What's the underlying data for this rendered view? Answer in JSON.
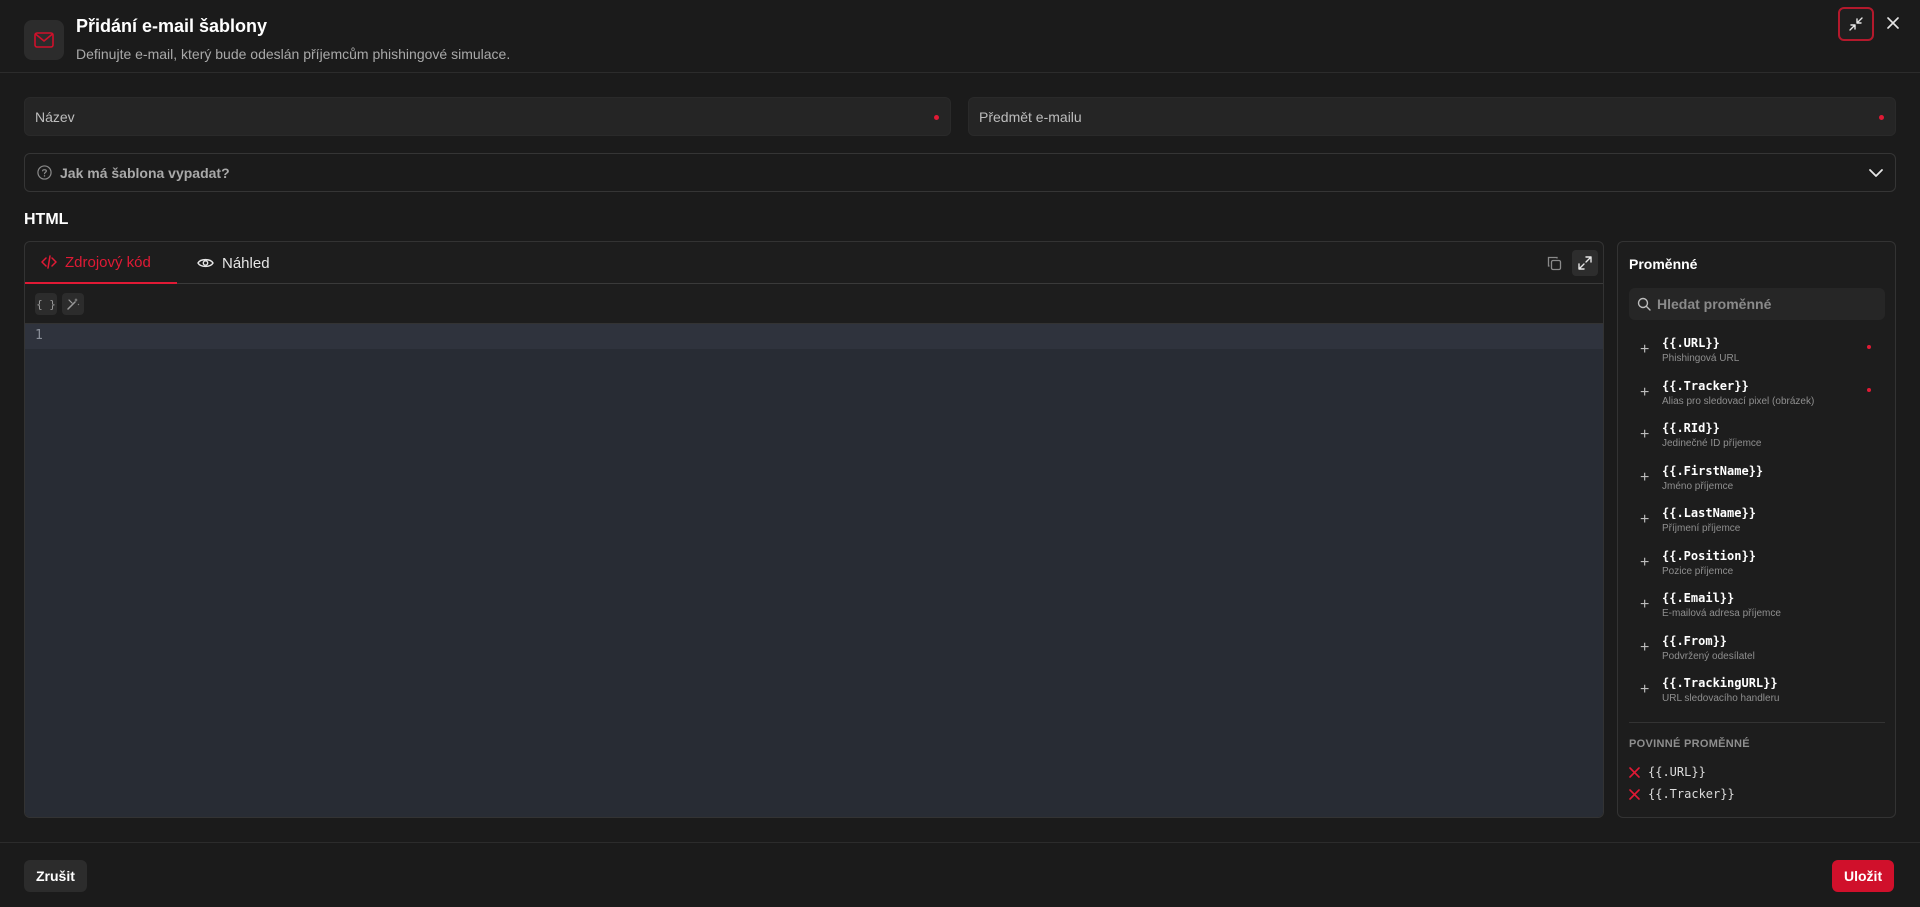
{
  "header": {
    "title": "Přidání e-mail šablony",
    "subtitle": "Definujte e-mail, který bude odeslán příjemcům phishingové simulace.",
    "icon": "mail-icon"
  },
  "form": {
    "name_placeholder": "Název",
    "subject_placeholder": "Předmět e-mailu",
    "accordion_label": "Jak má šablona vypadat?",
    "section_label": "HTML"
  },
  "editor": {
    "tab_source": "Zdrojový kód",
    "tab_preview": "Náhled",
    "format_tool": "{ }",
    "line_number": "1"
  },
  "variables": {
    "title": "Proměnné",
    "search_placeholder": "Hledat proměnné",
    "items": [
      {
        "name": "{{.URL}}",
        "desc": "Phishingová URL",
        "required": true
      },
      {
        "name": "{{.Tracker}}",
        "desc": "Alias pro sledovací pixel (obrázek)",
        "required": true
      },
      {
        "name": "{{.RId}}",
        "desc": "Jedinečné ID příjemce",
        "required": false
      },
      {
        "name": "{{.FirstName}}",
        "desc": "Jméno příjemce",
        "required": false
      },
      {
        "name": "{{.LastName}}",
        "desc": "Příjmení příjemce",
        "required": false
      },
      {
        "name": "{{.Position}}",
        "desc": "Pozice příjemce",
        "required": false
      },
      {
        "name": "{{.Email}}",
        "desc": "E-mailová adresa příjemce",
        "required": false
      },
      {
        "name": "{{.From}}",
        "desc": "Podvržený odesílatel",
        "required": false
      },
      {
        "name": "{{.TrackingURL}}",
        "desc": "URL sledovacího handleru",
        "required": false
      }
    ],
    "required_title": "POVINNÉ PROMĚNNÉ",
    "required_items": [
      "{{.URL}}",
      "{{.Tracker}}"
    ]
  },
  "footer": {
    "cancel_label": "Zrušit",
    "save_label": "Uložit"
  },
  "colors": {
    "accent": "#e01a35",
    "background": "#1b1b1b",
    "code_bg": "#282c34"
  }
}
